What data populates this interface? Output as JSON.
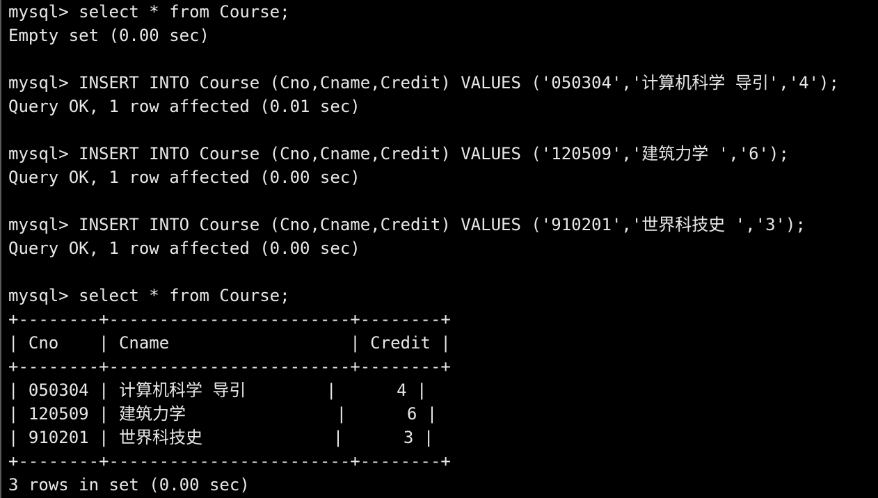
{
  "terminal": {
    "lines": [
      "mysql> select * from Course;",
      "Empty set (0.00 sec)",
      "",
      "mysql> INSERT INTO Course (Cno,Cname,Credit) VALUES ('050304','计算机科学 导引','4');",
      "Query OK, 1 row affected (0.01 sec)",
      "",
      "mysql> INSERT INTO Course (Cno,Cname,Credit) VALUES ('120509','建筑力学 ','6');",
      "Query OK, 1 row affected (0.00 sec)",
      "",
      "mysql> INSERT INTO Course (Cno,Cname,Credit) VALUES ('910201','世界科技史 ','3');",
      "Query OK, 1 row affected (0.00 sec)",
      "",
      "mysql> select * from Course;",
      "+--------+------------------------+--------+",
      "| Cno    | Cname                  | Credit |",
      "+--------+------------------------+--------+",
      "| 050304 | 计算机科学 导引        |      4 |",
      "| 120509 | 建筑力学               |      6 |",
      "| 910201 | 世界科技史             |      3 |",
      "+--------+------------------------+--------+",
      "3 rows in set (0.00 sec)"
    ]
  }
}
